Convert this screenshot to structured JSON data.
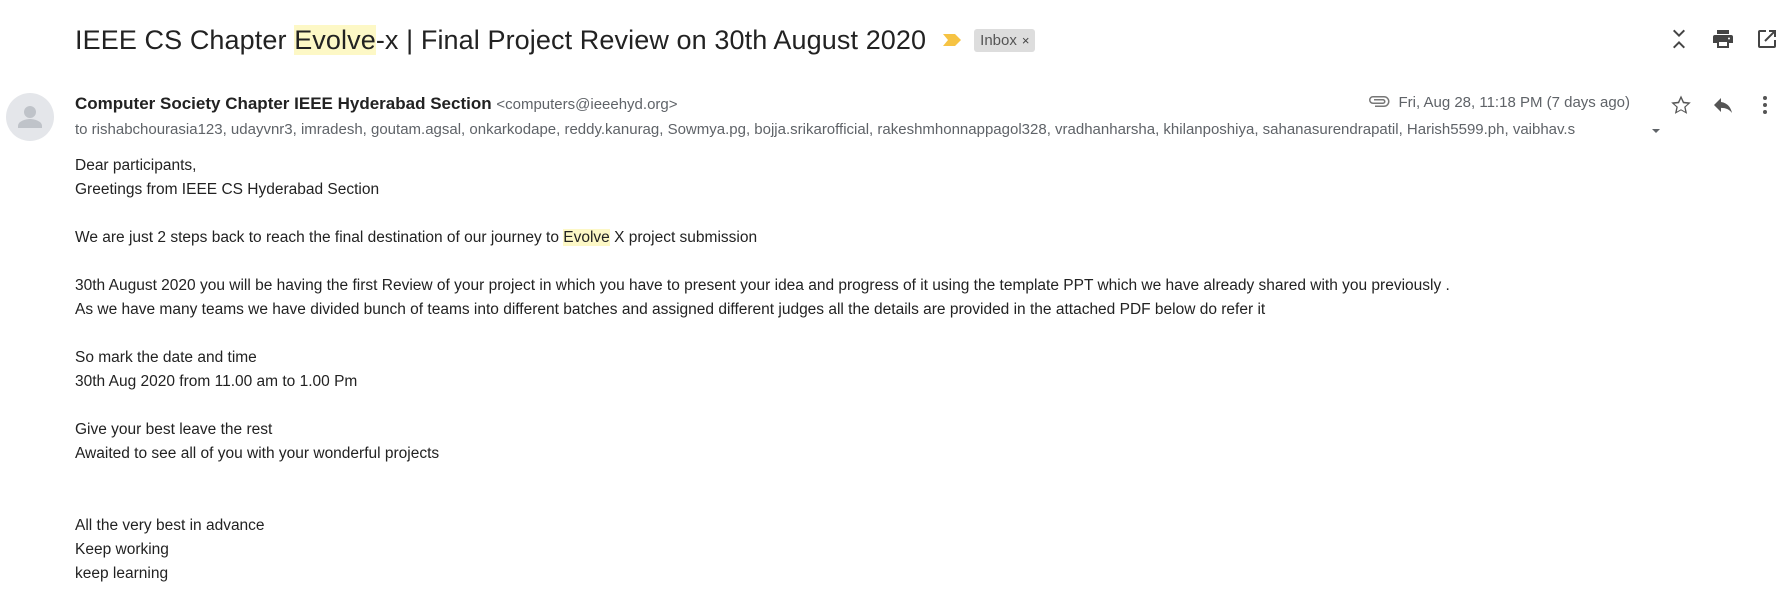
{
  "subject": {
    "part1": "IEEE CS Chapter ",
    "highlight": "Evolve",
    "part2": "-x | Final Project Review on 30th August 2020",
    "label_chip": "Inbox",
    "label_close": "×",
    "important_icon": "important-label-icon"
  },
  "top_actions": {
    "collapse_icon": "collapse-all-icon",
    "print_icon": "print-icon",
    "new_window_icon": "open-in-new-window-icon"
  },
  "message": {
    "sender_name": "Computer Society Chapter IEEE Hyderabad Section",
    "sender_email": "<computers@ieeehyd.org>",
    "recipients": "to rishabchourasia123, udayvnr3, imradesh, goutam.agsal, onkarkodape, reddy.kanurag, Sowmya.pg, bojja.srikarofficial, rakeshmhonnappagol328, vradhanharsha, khilanposhiya, sahanasurendrapatil, Harish5599.ph, vaibhav.s",
    "date": "Fri, Aug 28, 11:18 PM (7 days ago)",
    "attachment_icon": "paperclip-icon",
    "star_icon": "star-icon",
    "reply_icon": "reply-icon",
    "more_icon": "more-vert-icon"
  },
  "body": {
    "l1": "Dear participants,",
    "l2": "Greetings from IEEE CS Hyderabad Section",
    "l3a": "We are just 2 steps  back to reach the final destination of our journey to ",
    "l3hl": "Evolve",
    "l3b": " X project submission",
    "l4": "30th August 2020 you will be having the first Review of your project in which you have to present your idea and progress of it using the template PPT which we have already shared with you previously .",
    "l5": "As we have many teams we have divided bunch of teams into different batches and assigned different judges all the details are provided in the attached PDF below do refer it",
    "l6": "So mark the date and time",
    "l7": "30th Aug 2020 from 11.00 am to 1.00 Pm",
    "l8": "Give your best leave the rest",
    "l9": "Awaited to see all of you with your wonderful projects",
    "l10": "All the very best in advance",
    "l11": "Keep working",
    "l12": "keep learning"
  },
  "colors": {
    "highlight": "#fdf8c6",
    "important": "#f6c343",
    "chip_bg": "#dddddd"
  }
}
